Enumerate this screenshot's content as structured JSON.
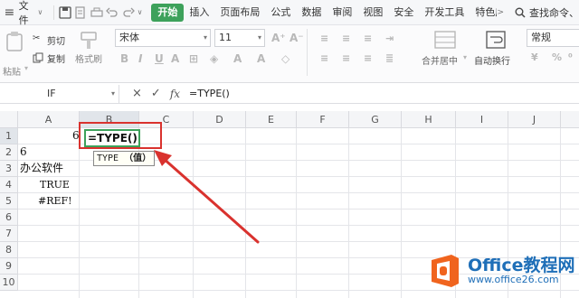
{
  "menubar": {
    "file": "文件",
    "tabs": [
      "开始",
      "插入",
      "页面布局",
      "公式",
      "数据",
      "审阅",
      "视图",
      "安全",
      "开发工具",
      "特色应"
    ],
    "active_tab": "开始",
    "search": "查找命令、"
  },
  "ribbon": {
    "paste": "粘贴",
    "cut": "剪切",
    "copy": "复制",
    "format_painter": "格式刷",
    "font_name": "宋体",
    "font_size": "11",
    "font_grow": "A⁺",
    "font_shrink": "A⁻",
    "merge": "合并居中",
    "wrap": "自动换行",
    "number_format": "常规"
  },
  "formula_bar": {
    "name_box": "IF",
    "cancel": "×",
    "confirm": "✓",
    "fx": "fx",
    "formula": "=TYPE()"
  },
  "grid": {
    "columns": [
      "A",
      "B",
      "C",
      "D",
      "E",
      "F",
      "G",
      "H",
      "I",
      "J"
    ],
    "rows": [
      "1",
      "2",
      "3",
      "4",
      "5",
      "6",
      "7",
      "8",
      "9",
      "10"
    ],
    "cells": {
      "a1": "6",
      "a2": "6",
      "a3": "办公软件",
      "a4": "TRUE",
      "a5": "#REF!"
    },
    "editing_cell_text": "=TYPE()",
    "tooltip_fn": "TYPE",
    "tooltip_arg": "（值）"
  },
  "watermark": {
    "line1": "Office教程网",
    "line2": "www.office26.com"
  },
  "colors": {
    "accent_green": "#3da15b",
    "annotation_red": "#d9322e",
    "watermark_orange": "#f0641e",
    "watermark_blue": "#1f6fb8"
  }
}
